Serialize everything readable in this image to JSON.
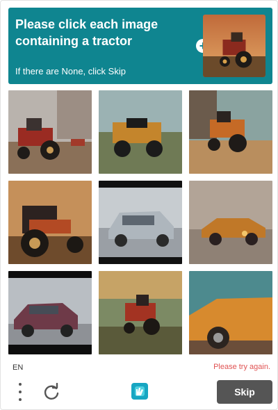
{
  "header": {
    "prompt": "Please click each image containing a tractor",
    "hint": "If there are None, click Skip",
    "example_image": "tractor"
  },
  "tiles": [
    {
      "subject": "tractor"
    },
    {
      "subject": "tractor"
    },
    {
      "subject": "tractor"
    },
    {
      "subject": "tractor"
    },
    {
      "subject": "car"
    },
    {
      "subject": "car"
    },
    {
      "subject": "car"
    },
    {
      "subject": "tractor"
    },
    {
      "subject": "car"
    }
  ],
  "footer": {
    "language": "EN",
    "error": "Please try again.",
    "skip_label": "Skip"
  },
  "colors": {
    "header_bg": "#0f8590",
    "error": "#e05252",
    "skip_bg": "#555555"
  }
}
